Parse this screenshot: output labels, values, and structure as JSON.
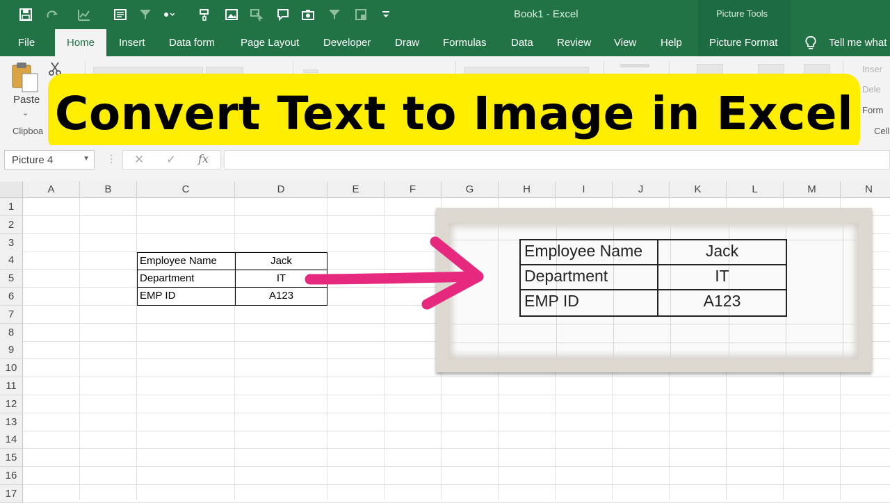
{
  "app": {
    "doc_title": "Book1  -  Excel",
    "context_group": "Picture Tools"
  },
  "tabs": [
    "File",
    "Home",
    "Insert",
    "Data form",
    "Page Layout",
    "Developer",
    "Draw",
    "Formulas",
    "Data",
    "Review",
    "View",
    "Help",
    "Picture Format"
  ],
  "active_tab": "Home",
  "tell_me": "Tell me what",
  "ribbon": {
    "paste_label": "Paste",
    "clipboard_group": "Clipboa",
    "cells_insert": "Inser",
    "cells_delete": "Dele",
    "cells_format": "Form",
    "cells_group": "Cell"
  },
  "banner": {
    "text": "Convert Text to Image in Excel",
    "color": "#ffee00"
  },
  "formula_bar": {
    "name_box": "Picture 4",
    "fx": "fx",
    "formula": ""
  },
  "columns": [
    "A",
    "B",
    "C",
    "D",
    "E",
    "F",
    "G",
    "H",
    "I",
    "J",
    "K",
    "L",
    "M",
    "N"
  ],
  "rows": [
    "1",
    "2",
    "3",
    "4",
    "5",
    "6",
    "7",
    "8",
    "9",
    "10",
    "11",
    "12",
    "13",
    "14",
    "15",
    "16",
    "17"
  ],
  "table": [
    {
      "label": "Employee Name",
      "value": "Jack"
    },
    {
      "label": "Department",
      "value": "IT"
    },
    {
      "label": "EMP ID",
      "value": "A123"
    }
  ],
  "colors": {
    "excel_green": "#217346",
    "arrow": "#e6287e"
  }
}
